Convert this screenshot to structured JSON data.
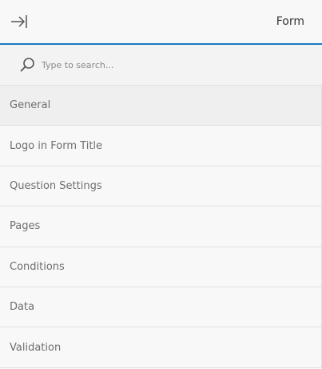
{
  "header": {
    "title": "Form",
    "collapse_icon": "collapse-right-icon"
  },
  "search": {
    "placeholder": "Type to search...",
    "value": "",
    "icon": "search-icon"
  },
  "sections": [
    {
      "label": "General",
      "active": true
    },
    {
      "label": "Logo in Form Title",
      "active": false
    },
    {
      "label": "Question Settings",
      "active": false
    },
    {
      "label": "Pages",
      "active": false
    },
    {
      "label": "Conditions",
      "active": false
    },
    {
      "label": "Data",
      "active": false
    },
    {
      "label": "Validation",
      "active": false
    }
  ],
  "colors": {
    "accent": "#1979c3",
    "background": "#f8f8f8",
    "active_row": "#efefef",
    "text_muted": "#6e6e6e"
  }
}
